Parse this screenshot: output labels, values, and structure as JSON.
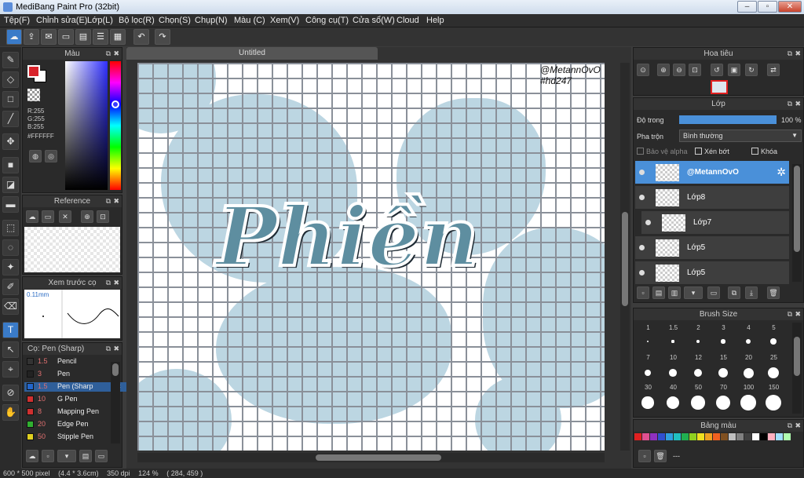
{
  "app": {
    "title": "MediBang Paint Pro (32bit)"
  },
  "window_buttons": [
    "–",
    "▫",
    "✕"
  ],
  "menu": [
    "Tệp(F)",
    "Chỉnh sửa(E)",
    "Lớp(L)",
    "Bộ lọc(R)",
    "Chọn(S)",
    "Chụp(N)",
    "Màu (C)",
    "Xem(V)",
    "Công cụ(T)",
    "Cửa sổ(W)",
    "Cloud",
    "Help"
  ],
  "color_panel": {
    "title": "Màu",
    "r": "R:255",
    "g": "G:255",
    "b": "B:255",
    "hex": "#FFFFFF",
    "fg_color": "#d8222a",
    "bg_color": "#ffffff"
  },
  "reference_panel": {
    "title": "Reference"
  },
  "brush_preview_panel": {
    "title": "Xem trước cọ",
    "size": "0.11mm"
  },
  "brush_panel": {
    "title": "Cọ: Pen (Sharp)",
    "items": [
      {
        "size": "1.5",
        "name": "Pencil",
        "color": "#333333"
      },
      {
        "size": "3",
        "name": "Pen",
        "color": "#222222"
      },
      {
        "size": "1.5",
        "name": "Pen (Sharp",
        "color": "#2266cc",
        "selected": true
      },
      {
        "size": "10",
        "name": "G Pen",
        "color": "#d03030"
      },
      {
        "size": "8",
        "name": "Mapping Pen",
        "color": "#d03030"
      },
      {
        "size": "20",
        "name": "Edge Pen",
        "color": "#30b030"
      },
      {
        "size": "50",
        "name": "Stipple Pen",
        "color": "#e0d020"
      }
    ]
  },
  "document": {
    "tab": "Untitled",
    "watermark_line1": "@MetannOvO",
    "watermark_line2": "#hd247",
    "art_text": "Phiền"
  },
  "navigator_panel": {
    "title": "Hoa tiêu"
  },
  "layer_panel": {
    "title": "Lớp",
    "opacity_label": "Độ trong",
    "opacity_value": "100 %",
    "blend_label": "Pha trộn",
    "blend_value": "Bình thường",
    "protect_alpha": "Bảo vệ alpha",
    "clip": "Xén bớt",
    "lock": "Khóa",
    "layers": [
      {
        "name": "@MetannOvO",
        "selected": true
      },
      {
        "name": "Lớp8"
      },
      {
        "name": "Lớp7"
      },
      {
        "name": "Lớp5"
      },
      {
        "name": "Lớp5"
      }
    ]
  },
  "brush_size_panel": {
    "title": "Brush Size",
    "sizes": [
      "1",
      "1.5",
      "2",
      "3",
      "4",
      "5",
      "7",
      "10",
      "12",
      "15",
      "20",
      "25",
      "30",
      "40",
      "50",
      "70",
      "100",
      "150"
    ]
  },
  "palette_panel": {
    "title": "Bảng màu",
    "colors": [
      "#e02020",
      "#e05090",
      "#9030c0",
      "#3050d0",
      "#30a0e0",
      "#20c0c0",
      "#20b050",
      "#90d020",
      "#f0e020",
      "#f0a020",
      "#f06020",
      "#805020",
      "#c0c0c0",
      "#808080",
      "#404040",
      "#ffffff",
      "#000000",
      "#ffb0c0",
      "#a0e0ff",
      "#b0ffb0"
    ],
    "value": "---"
  },
  "status": {
    "size": "600 * 500 pixel",
    "cm": "(4.4 * 3.6cm)",
    "dpi": "350 dpi",
    "zoom": "124 %",
    "coords": "( 284, 459 )"
  }
}
